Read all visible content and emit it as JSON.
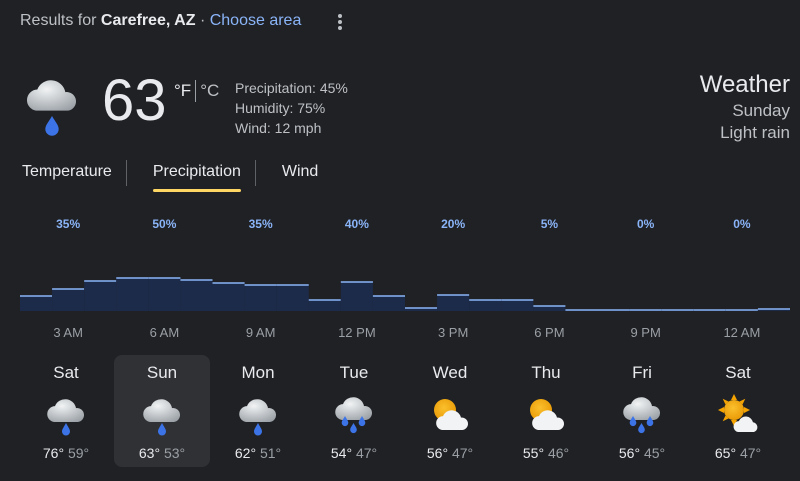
{
  "header": {
    "results_prefix": "Results for",
    "location": "Carefree, AZ",
    "separator": "·",
    "choose_area": "Choose area"
  },
  "current": {
    "icon": "rain-cloud-icon",
    "temperature": "63",
    "unit_f": "°F",
    "unit_c": "°C",
    "precipitation": "Precipitation: 45%",
    "humidity": "Humidity: 75%",
    "wind": "Wind: 12 mph"
  },
  "title": {
    "heading": "Weather",
    "day": "Sunday",
    "condition": "Light rain"
  },
  "tabs": [
    {
      "label": "Temperature"
    },
    {
      "label": "Precipitation"
    },
    {
      "label": "Wind"
    }
  ],
  "active_tab": "Precipitation",
  "colors": {
    "accent_underline": "#fdd663",
    "bar_fill": "#1d2b4a",
    "bar_line": "#8ab4f8",
    "percent_label": "#8ab4f8"
  },
  "chart_data": {
    "type": "bar",
    "categories": [
      "3 AM",
      "6 AM",
      "9 AM",
      "12 PM",
      "3 PM",
      "6 PM",
      "9 PM",
      "12 AM"
    ],
    "labeled_values": [
      "35%",
      "50%",
      "35%",
      "40%",
      "20%",
      "5%",
      "0%",
      "0%"
    ],
    "hourly_values": [
      15,
      22,
      30,
      33,
      33,
      31,
      28,
      26,
      26,
      11,
      29,
      15,
      3,
      16,
      11,
      11,
      5,
      1,
      1,
      1,
      1,
      1,
      1,
      2
    ],
    "ylim": [
      0,
      100
    ]
  },
  "days": [
    {
      "name": "Sat",
      "icon": "rain-cloud-icon",
      "high": "76°",
      "low": "59°"
    },
    {
      "name": "Sun",
      "icon": "rain-cloud-icon",
      "high": "63°",
      "low": "53°",
      "selected": true
    },
    {
      "name": "Mon",
      "icon": "rain-cloud-icon",
      "high": "62°",
      "low": "51°"
    },
    {
      "name": "Tue",
      "icon": "heavy-rain-cloud-icon",
      "high": "54°",
      "low": "47°"
    },
    {
      "name": "Wed",
      "icon": "partly-cloudy-icon",
      "high": "56°",
      "low": "47°"
    },
    {
      "name": "Thu",
      "icon": "partly-cloudy-icon",
      "high": "55°",
      "low": "46°"
    },
    {
      "name": "Fri",
      "icon": "heavy-rain-cloud-icon",
      "high": "56°",
      "low": "45°"
    },
    {
      "name": "Sat",
      "icon": "mostly-sunny-icon",
      "high": "65°",
      "low": "47°"
    }
  ]
}
